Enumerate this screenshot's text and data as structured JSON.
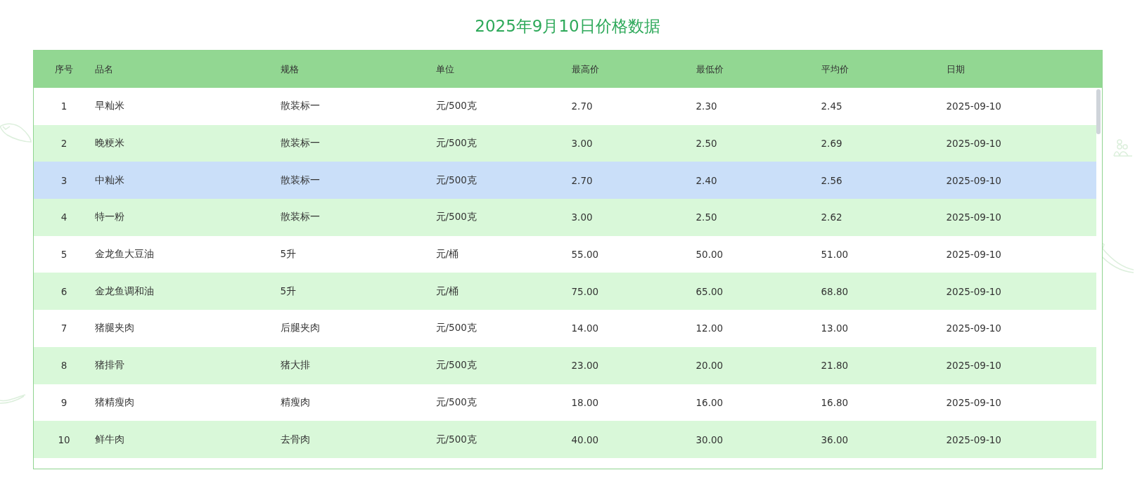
{
  "title": "2025年9月10日价格数据",
  "table": {
    "columns": [
      "序号",
      "品名",
      "规格",
      "单位",
      "最高价",
      "最低价",
      "平均价",
      "日期"
    ],
    "rows": [
      {
        "selected": false,
        "cells": [
          "1",
          "早籼米",
          "散装标一",
          "元/500克",
          "2.70",
          "2.30",
          "2.45",
          "2025-09-10"
        ]
      },
      {
        "selected": false,
        "cells": [
          "2",
          "晚粳米",
          "散装标一",
          "元/500克",
          "3.00",
          "2.50",
          "2.69",
          "2025-09-10"
        ]
      },
      {
        "selected": true,
        "cells": [
          "3",
          "中籼米",
          "散装标一",
          "元/500克",
          "2.70",
          "2.40",
          "2.56",
          "2025-09-10"
        ]
      },
      {
        "selected": false,
        "cells": [
          "4",
          "特一粉",
          "散装标一",
          "元/500克",
          "3.00",
          "2.50",
          "2.62",
          "2025-09-10"
        ]
      },
      {
        "selected": false,
        "cells": [
          "5",
          "金龙鱼大豆油",
          "5升",
          "元/桶",
          "55.00",
          "50.00",
          "51.00",
          "2025-09-10"
        ]
      },
      {
        "selected": false,
        "cells": [
          "6",
          "金龙鱼调和油",
          "5升",
          "元/桶",
          "75.00",
          "65.00",
          "68.80",
          "2025-09-10"
        ]
      },
      {
        "selected": false,
        "cells": [
          "7",
          "猪腿夹肉",
          "后腿夹肉",
          "元/500克",
          "14.00",
          "12.00",
          "13.00",
          "2025-09-10"
        ]
      },
      {
        "selected": false,
        "cells": [
          "8",
          "猪排骨",
          "猪大排",
          "元/500克",
          "23.00",
          "20.00",
          "21.80",
          "2025-09-10"
        ]
      },
      {
        "selected": false,
        "cells": [
          "9",
          "猪精瘦肉",
          "精瘦肉",
          "元/500克",
          "18.00",
          "16.00",
          "16.80",
          "2025-09-10"
        ]
      },
      {
        "selected": false,
        "cells": [
          "10",
          "鲜牛肉",
          "去骨肉",
          "元/500克",
          "40.00",
          "30.00",
          "36.00",
          "2025-09-10"
        ]
      }
    ]
  }
}
